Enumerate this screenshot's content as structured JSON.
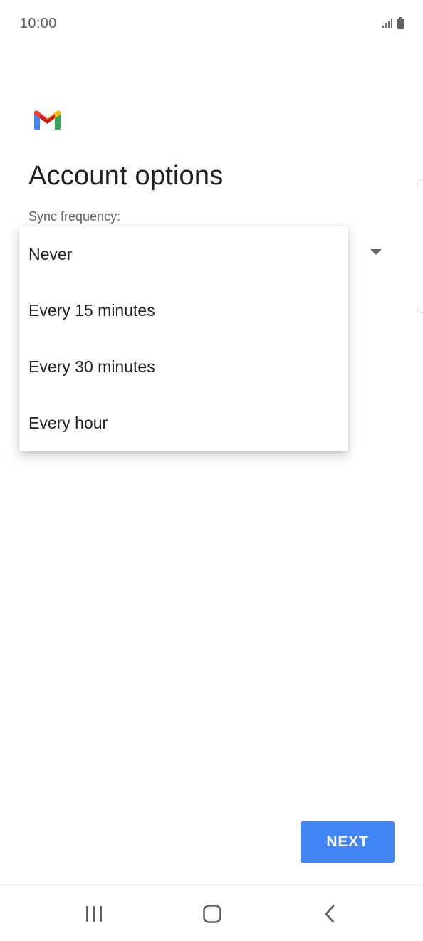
{
  "status_bar": {
    "time": "10:00",
    "icons": [
      "signal-icon",
      "battery-icon"
    ]
  },
  "app": {
    "logo_icon": "gmail-logo-icon",
    "colors": {
      "red": "#ea4335",
      "blue": "#4285f4",
      "green": "#34a853",
      "yellow": "#fbbc04"
    }
  },
  "page": {
    "title": "Account options",
    "sync_label": "Sync frequency:"
  },
  "dropdown": {
    "options": [
      {
        "label": "Never"
      },
      {
        "label": "Every 15 minutes"
      },
      {
        "label": "Every 30 minutes"
      },
      {
        "label": "Every hour"
      }
    ]
  },
  "footer": {
    "next_label": "NEXT",
    "next_color": "#4285f4"
  },
  "nav_bar": {
    "icons": [
      "recent-apps-icon",
      "home-icon",
      "back-icon"
    ]
  }
}
